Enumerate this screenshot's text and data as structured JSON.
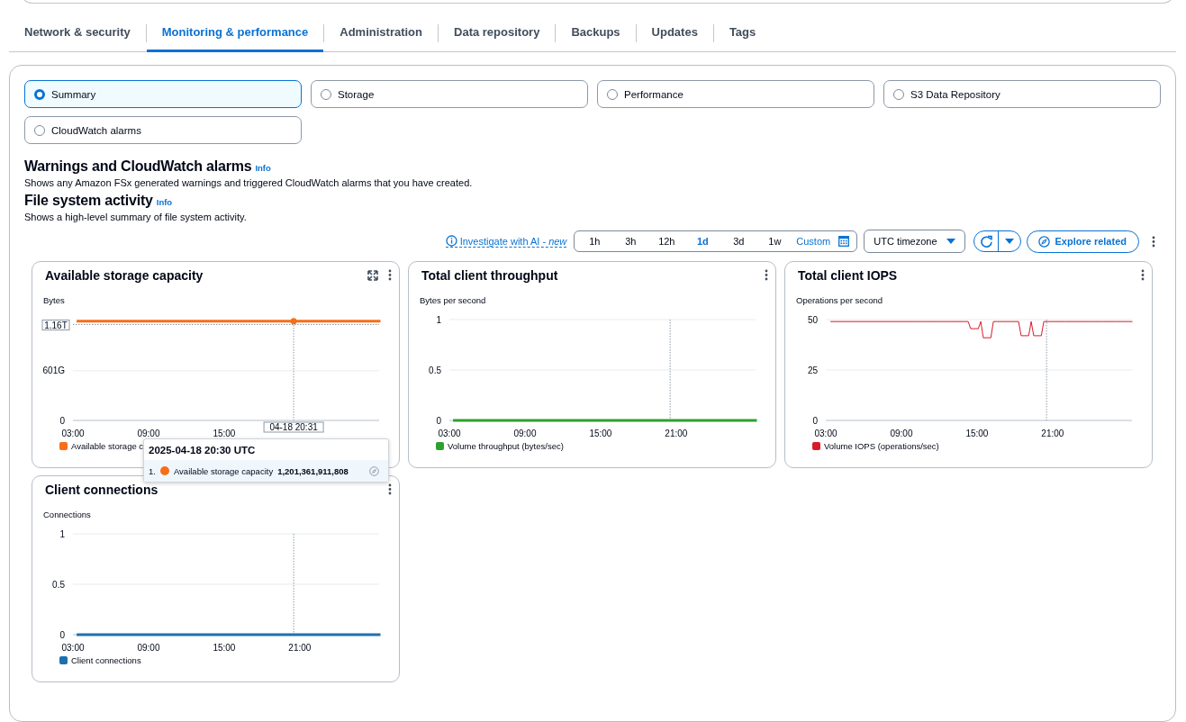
{
  "tabs": [
    {
      "label": "Network & security",
      "selected": false
    },
    {
      "label": "Monitoring & performance",
      "selected": true
    },
    {
      "label": "Administration",
      "selected": false
    },
    {
      "label": "Data repository",
      "selected": false
    },
    {
      "label": "Backups",
      "selected": false
    },
    {
      "label": "Updates",
      "selected": false
    },
    {
      "label": "Tags",
      "selected": false
    }
  ],
  "views": [
    {
      "label": "Summary",
      "selected": true
    },
    {
      "label": "Storage",
      "selected": false
    },
    {
      "label": "Performance",
      "selected": false
    },
    {
      "label": "S3 Data Repository",
      "selected": false
    },
    {
      "label": "CloudWatch alarms",
      "selected": false
    }
  ],
  "sections": [
    {
      "title": "Warnings and CloudWatch alarms",
      "info": "Info",
      "description": "Shows any Amazon FSx generated warnings and triggered CloudWatch alarms that you have created."
    },
    {
      "title": "File system activity",
      "info": "Info",
      "description": "Shows a high-level summary of file system activity."
    }
  ],
  "toolbar": {
    "investigate": "Investigate with AI - *new*",
    "ranges": [
      {
        "label": "1h",
        "selected": false
      },
      {
        "label": "3h",
        "selected": false
      },
      {
        "label": "12h",
        "selected": false
      },
      {
        "label": "1d",
        "selected": true
      },
      {
        "label": "3d",
        "selected": false
      },
      {
        "label": "1w",
        "selected": false
      }
    ],
    "custom": "Custom",
    "timezone": "UTC timezone",
    "explore": "Explore related"
  },
  "widgets": [
    {
      "title": "Available storage capacity",
      "expandable": true,
      "cursor_time": "04-18 20:31",
      "chart_data": {
        "type": "line",
        "ylabel": "Bytes",
        "x": [
          3.4,
          27.3
        ],
        "xlim": [
          3,
          27.3
        ],
        "ylim": [
          0,
          1220
        ],
        "xticks": [
          {
            "value": 3,
            "label": "03:00"
          },
          {
            "value": 9,
            "label": "09:00"
          },
          {
            "value": 15,
            "label": "15:00"
          }
        ],
        "yticks": [
          0,
          {
            "value": 601,
            "label": "601G"
          }
        ],
        "series": [
          {
            "name": "Available storage c",
            "color": "#f76e18",
            "values": [
              1200,
              1200
            ]
          }
        ],
        "ref_lines": [
          {
            "axis": "x",
            "value": 20.5167
          },
          {
            "axis": "y",
            "value": 1160,
            "label": "1.16T"
          }
        ]
      },
      "tooltip": {
        "title": "2025-04-18 20:30 UTC",
        "rows": [
          {
            "index": "1.",
            "name": "Available storage capacity",
            "value": "1,201,361,911,808",
            "color": "#f76e18"
          }
        ]
      }
    },
    {
      "title": "Total client throughput",
      "expandable": false,
      "chart_data": {
        "type": "line",
        "ylabel": "Bytes per second",
        "x": [
          3.4,
          27.3
        ],
        "ref_lines": [
          {
            "axis": "x",
            "value": 20.52
          }
        ],
        "xlim": [
          3,
          27.3
        ],
        "ylim": [
          0,
          1
        ],
        "xticks": [
          {
            "value": 3,
            "label": "03:00"
          },
          {
            "value": 9,
            "label": "09:00"
          },
          {
            "value": 15,
            "label": "15:00"
          },
          {
            "value": 21,
            "label": "21:00"
          }
        ],
        "yticks": [
          0,
          0.5,
          1
        ],
        "series": [
          {
            "name": "Volume throughput (bytes/sec)",
            "color": "#2ea02e",
            "values": [
              0,
              0
            ]
          }
        ]
      }
    },
    {
      "title": "Total client IOPS",
      "expandable": false,
      "chart_data": {
        "type": "line",
        "ylabel": "Operations per second",
        "ref_lines": [
          {
            "axis": "x",
            "value": 20.52
          }
        ],
        "x": [
          3.4,
          4,
          5,
          6,
          7,
          8,
          9,
          10,
          11,
          12,
          13,
          14,
          14.3,
          14.5,
          15.1,
          15.3,
          15.5,
          16.1,
          16.3,
          17,
          18,
          18.3,
          18.5,
          19.1,
          19.3,
          19.5,
          20.1,
          20.3,
          21,
          22,
          23,
          24,
          25,
          26,
          27,
          27.3
        ],
        "xlim": [
          3,
          27.3
        ],
        "ylim": [
          0,
          50
        ],
        "xticks": [
          {
            "value": 3,
            "label": "03:00"
          },
          {
            "value": 9,
            "label": "09:00"
          },
          {
            "value": 15,
            "label": "15:00"
          },
          {
            "value": 21,
            "label": "21:00"
          }
        ],
        "yticks": [
          0,
          25,
          50
        ],
        "series": [
          {
            "name": "Volume IOPS (operations/sec)",
            "color": "#d91a2a",
            "values": [
              49,
              49,
              49,
              49,
              49,
              49,
              49,
              49,
              49,
              49,
              49,
              49,
              49,
              45.5,
              45.5,
              49,
              41,
              41,
              49,
              49,
              49,
              49,
              42,
              42,
              49,
              42,
              42,
              49,
              49,
              49,
              49,
              49,
              49,
              49,
              49,
              49
            ]
          }
        ]
      }
    },
    {
      "title": "Client connections",
      "expandable": false,
      "chart_data": {
        "type": "line",
        "ylabel": "Connections",
        "x": [
          3.4,
          27.3
        ],
        "ref_lines": [
          {
            "axis": "x",
            "value": 20.52
          }
        ],
        "xlim": [
          3,
          27.3
        ],
        "ylim": [
          0,
          1
        ],
        "xticks": [
          {
            "value": 3,
            "label": "03:00"
          },
          {
            "value": 9,
            "label": "09:00"
          },
          {
            "value": 15,
            "label": "15:00"
          },
          {
            "value": 21,
            "label": "21:00"
          }
        ],
        "yticks": [
          0,
          0.5,
          1
        ],
        "series": [
          {
            "name": "Client connections",
            "color": "#1f6fb0",
            "values": [
              0,
              0
            ]
          }
        ]
      }
    }
  ]
}
